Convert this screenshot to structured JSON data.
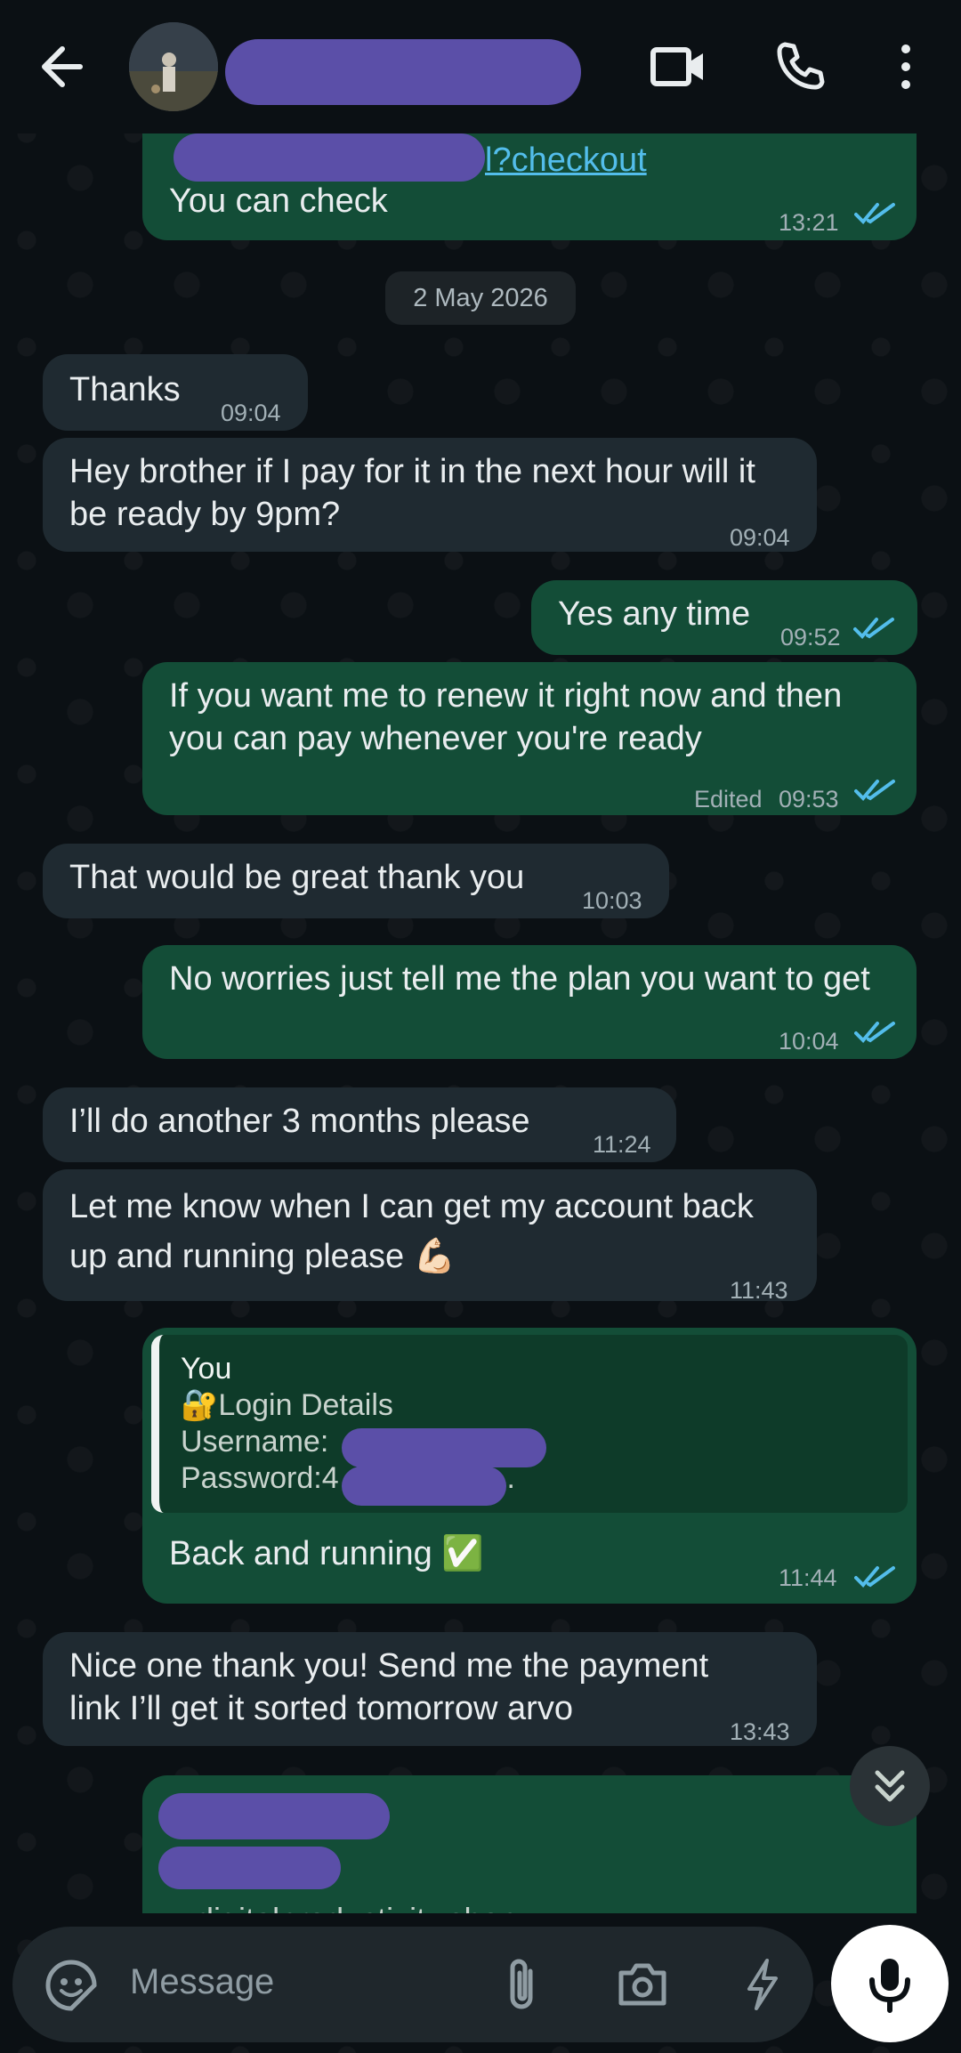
{
  "header": {
    "contact_name": "",
    "back_label": "Back",
    "video_label": "Video call",
    "call_label": "Voice call",
    "more_label": "More options"
  },
  "messages": [
    {
      "dir": "out",
      "link_text": "l?checkout",
      "text": "You can check",
      "time": "13:21",
      "status": "read"
    },
    {
      "dir": "date",
      "text": "2 May 2026"
    },
    {
      "dir": "in",
      "text": "Thanks",
      "time": "09:04"
    },
    {
      "dir": "in",
      "text": "Hey brother if I pay for it in the next hour will it be ready by 9pm?",
      "time": "09:04"
    },
    {
      "dir": "out",
      "text": "Yes any time",
      "time": "09:52",
      "status": "read"
    },
    {
      "dir": "out",
      "text": "If you want me to renew it right now and then you can pay whenever you're ready",
      "edited": "Edited",
      "time": "09:53",
      "status": "read"
    },
    {
      "dir": "in",
      "text": "That would be great thank you",
      "time": "10:03"
    },
    {
      "dir": "out",
      "text": "No worries just tell me the plan you want to get",
      "time": "10:04",
      "status": "read"
    },
    {
      "dir": "in",
      "text": "I’ll do another 3 months please",
      "time": "11:24"
    },
    {
      "dir": "in",
      "text": "Let me know when I can get my account back up and running please 💪🏻",
      "time": "11:43"
    },
    {
      "dir": "out",
      "quote_author": "You",
      "quote_line1": "🔐Login Details",
      "quote_line2": "Username:",
      "quote_line3": "Password:4",
      "quote_line3_tail": "...",
      "text": "Back and running ✅",
      "time": "11:44",
      "status": "read"
    },
    {
      "dir": "in",
      "text": "Nice one thank you! Send me the payment link I’ll get it sorted tomorrow arvo",
      "time": "13:43"
    },
    {
      "dir": "out",
      "link_text": "digitalproductivity.shop"
    }
  ],
  "composer": {
    "placeholder": "Message"
  },
  "colors": {
    "background": "#0b1014",
    "incoming_bubble": "#1f2a31",
    "outgoing_bubble": "#134d37",
    "read_ticks": "#53bdeb",
    "redaction": "#5b4fa8"
  }
}
